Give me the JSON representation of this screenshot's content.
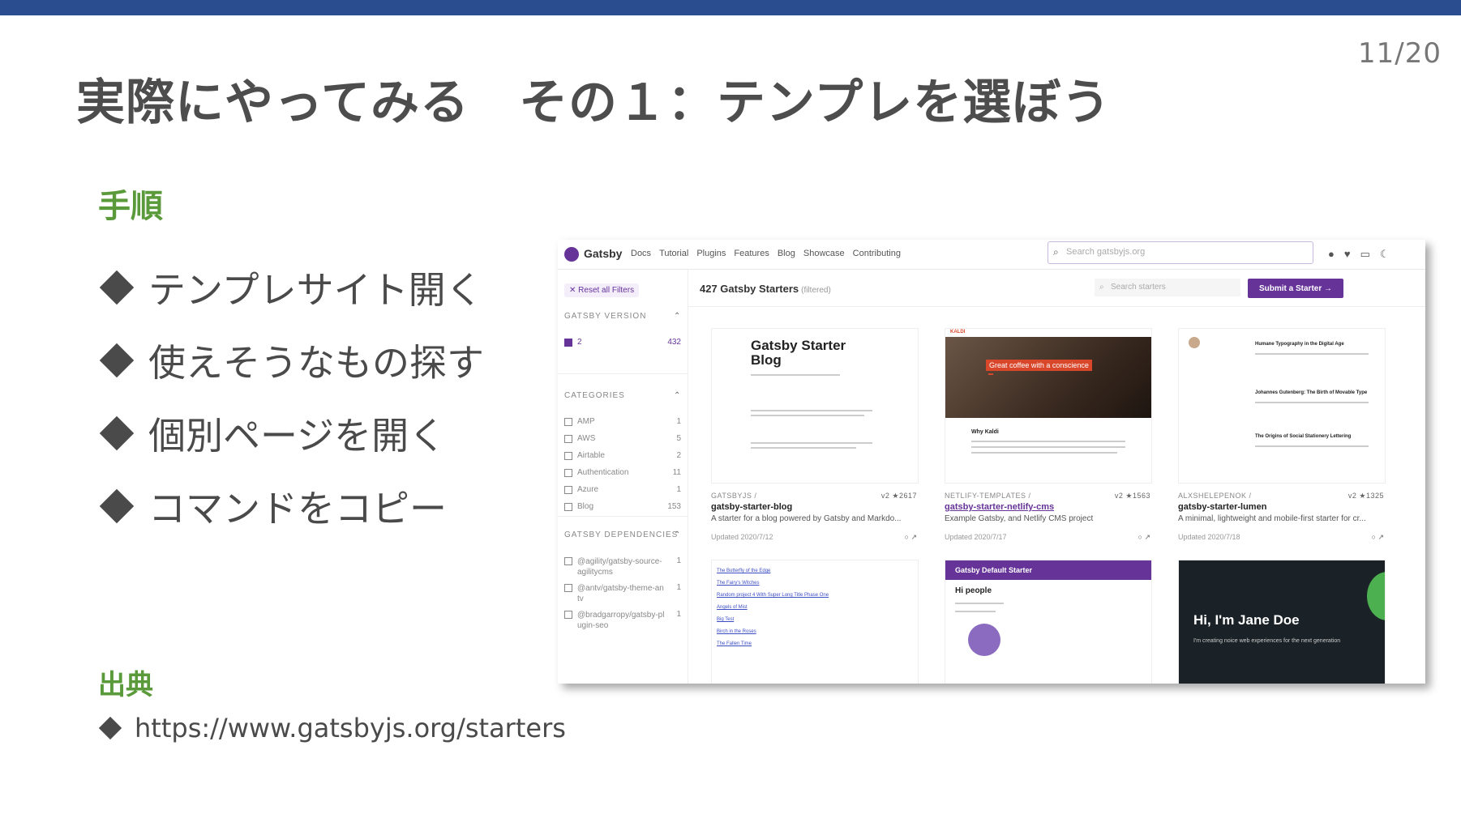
{
  "slide": {
    "page_number": "11/20",
    "title": "実際にやってみる　その１：テンプレを選ぼう",
    "steps_heading": "手順",
    "steps": [
      "テンプレサイト開く",
      "使えそうなもの探す",
      "個別ページを開く",
      "コマンドをコピー"
    ],
    "source_heading": "出典",
    "source_url": "https://www.gatsbyjs.org/starters"
  },
  "colors": {
    "top_bar": "#2a4d8f",
    "heading_green": "#5a9a3a",
    "gatsby_purple": "#663399"
  },
  "gatsby": {
    "brand": "Gatsby",
    "nav": [
      "Docs",
      "Tutorial",
      "Plugins",
      "Features",
      "Blog",
      "Showcase",
      "Contributing"
    ],
    "search_placeholder": "Search gatsbyjs.org",
    "header_icons": [
      "github-icon",
      "twitter-icon",
      "discord-icon",
      "moon-icon"
    ],
    "reset_filters": "✕  Reset all Filters",
    "version_heading": "GATSBY VERSION",
    "version_option": {
      "label": "2",
      "count": "432",
      "checked": true
    },
    "categories_heading": "CATEGORIES",
    "categories": [
      {
        "label": "AMP",
        "count": "1"
      },
      {
        "label": "AWS",
        "count": "5"
      },
      {
        "label": "Airtable",
        "count": "2"
      },
      {
        "label": "Authentication",
        "count": "11"
      },
      {
        "label": "Azure",
        "count": "1"
      },
      {
        "label": "Blog",
        "count": "153"
      }
    ],
    "deps_heading": "GATSBY DEPENDENCIES",
    "deps": [
      {
        "label": "@agility/gatsby-source-agilitycms",
        "count": "1"
      },
      {
        "label": "@antv/gatsby-theme-antv",
        "count": "1"
      },
      {
        "label": "@bradgarropy/gatsby-plugin-seo",
        "count": "1"
      }
    ],
    "starter_count": "427 Gatsby Starters",
    "filtered": "(filtered)",
    "starter_search_placeholder": "Search starters",
    "submit_button": "Submit a Starter →",
    "cards": [
      {
        "owner": "GATSBYJS /",
        "stats": "v2  ★2617",
        "name": "gatsby-starter-blog",
        "desc": "A starter for a blog powered by Gatsby and Markdo...",
        "updated": "Updated 2020/7/12",
        "thumb_title": "Gatsby Starter Blog"
      },
      {
        "owner": "NETLIFY-TEMPLATES /",
        "stats": "v2  ★1563",
        "name": "gatsby-starter-netlify-cms",
        "desc": "Example Gatsby, and Netlify CMS project",
        "updated": "Updated 2020/7/17",
        "thumb_banner": "Great coffee with a conscience",
        "thumb_title": "Why Kaldi",
        "thumb_logo": "KALDI"
      },
      {
        "owner": "ALXSHELEPENOK /",
        "stats": "v2  ★1325",
        "name": "gatsby-starter-lumen",
        "desc": "A minimal, lightweight and mobile-first starter for cr...",
        "updated": "Updated 2020/7/18",
        "thumb_headlines": [
          "Humane Typography in the Digital Age",
          "Johannes Gutenberg: The Birth of Movable Type",
          "The Origins of Social Stationery Lettering"
        ]
      }
    ],
    "cards_row2": [
      {
        "thumb_links": [
          "The Butterfly of the Edge",
          "The Fairy's Witches",
          "Random project 4 With Super Long Title Phase One",
          "Angels of Mist",
          "Big Test",
          "Birch in the Roses",
          "The Fallen Time"
        ]
      },
      {
        "thumb_bar": "Gatsby Default Starter",
        "thumb_title": "Hi people"
      },
      {
        "thumb_title": "Hi, I'm Jane Doe",
        "thumb_sub": "I'm creating noice web experiences for the next generation"
      }
    ]
  }
}
